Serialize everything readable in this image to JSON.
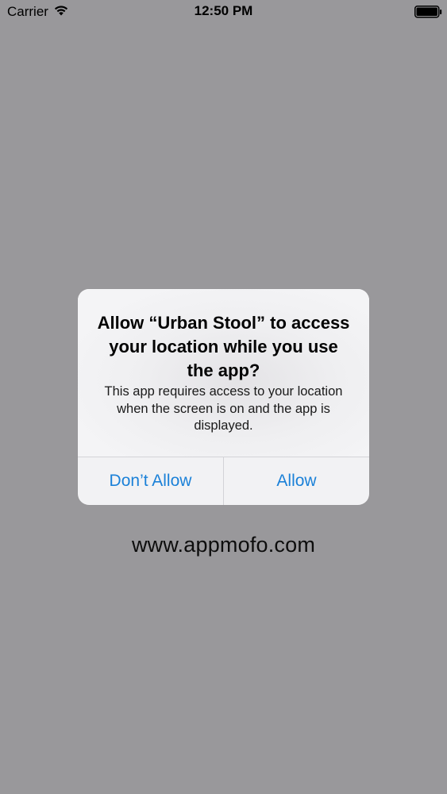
{
  "status_bar": {
    "carrier": "Carrier",
    "time": "12:50 PM",
    "wifi_icon": "wifi-icon",
    "battery_icon": "battery-full-icon"
  },
  "alert": {
    "title": "Allow “Urban Stool” to access your location while you use the app?",
    "message": "This app requires access to your location when the screen is on and the app is displayed.",
    "buttons": {
      "deny_label": "Don’t Allow",
      "allow_label": "Allow"
    },
    "button_color": "#1b81d8"
  },
  "watermark": "www.appmofo.com",
  "colors": {
    "background": "#99989b",
    "alert_background": "#f2f2f4"
  }
}
